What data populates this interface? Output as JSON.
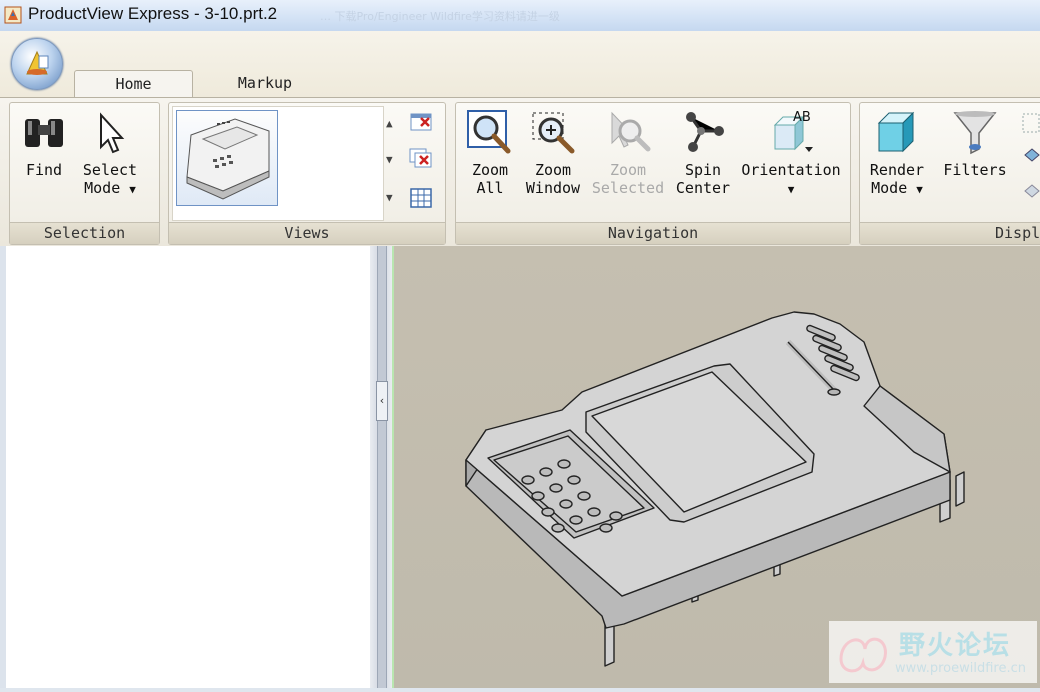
{
  "window": {
    "title": "ProductView Express - 3-10.prt.2",
    "ghost_text": "…  下载Pro/Engineer Wildfire学习资料请进一级"
  },
  "tabs": [
    {
      "label": "Home"
    },
    {
      "label": "Markup"
    }
  ],
  "groups": {
    "selection": {
      "label": "Selection",
      "find": "Find",
      "select_mode_l1": "Select",
      "select_mode_l2": "Mode"
    },
    "views": {
      "label": "Views"
    },
    "navigation": {
      "label": "Navigation",
      "zoom_all_l1": "Zoom",
      "zoom_all_l2": "All",
      "zoom_window_l1": "Zoom",
      "zoom_window_l2": "Window",
      "zoom_selected_l1": "Zoom",
      "zoom_selected_l2": "Selected",
      "spin_center_l1": "Spin",
      "spin_center_l2": "Center",
      "orientation": "Orientation"
    },
    "display": {
      "label": "Displ",
      "render_mode_l1": "Render",
      "render_mode_l2": "Mode",
      "filters": "Filters"
    }
  },
  "watermark": {
    "title": "野火论坛",
    "url": "www.proewildfire.cn"
  },
  "colors": {
    "viewport_bg": "#c3beb0",
    "accent": "#6f93c5"
  }
}
